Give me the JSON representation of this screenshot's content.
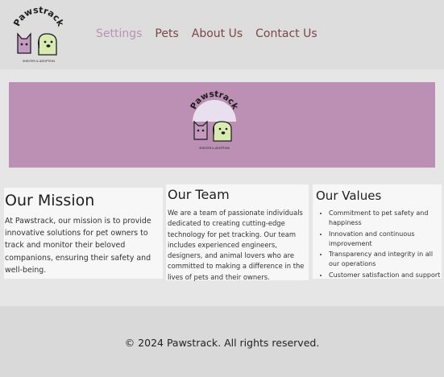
{
  "brand": {
    "name": "Pawstrack",
    "tagline": "SHELTER & ADOPTION",
    "colors": {
      "cat": "#c49ac0",
      "dog": "#d9ecb0",
      "outline": "#1c1c1c",
      "arc": "#e8e0ee"
    }
  },
  "nav": {
    "items": [
      {
        "label": "Settings",
        "active": true
      },
      {
        "label": "Pets"
      },
      {
        "label": "About Us"
      },
      {
        "label": "Contact Us"
      }
    ]
  },
  "mission": {
    "title": "Our Mission",
    "text": "At Pawstrack, our mission is to provide innovative solutions for pet owners to track and monitor their beloved companions, ensuring their safety and well-being."
  },
  "team": {
    "title": "Our Team",
    "text": "We are a team of passionate individuals dedicated to creating cutting-edge technology for pet tracking. Our team includes experienced engineers, designers, and animal lovers who are committed to making a difference in the lives of pets and their owners."
  },
  "values": {
    "title": "Our Values",
    "items": [
      "Commitment to pet safety and happiness",
      "Innovation and continuous improvement",
      "Transparency and integrity in all our operations",
      "Customer satisfaction and support"
    ]
  },
  "footer": {
    "text": "© 2024 Pawstrack. All rights reserved."
  },
  "theme": {
    "header_bg": "#dddddd",
    "banner_bg": "#bb90b4",
    "nav_active": "#b993b6",
    "nav_link": "#7a4848"
  }
}
